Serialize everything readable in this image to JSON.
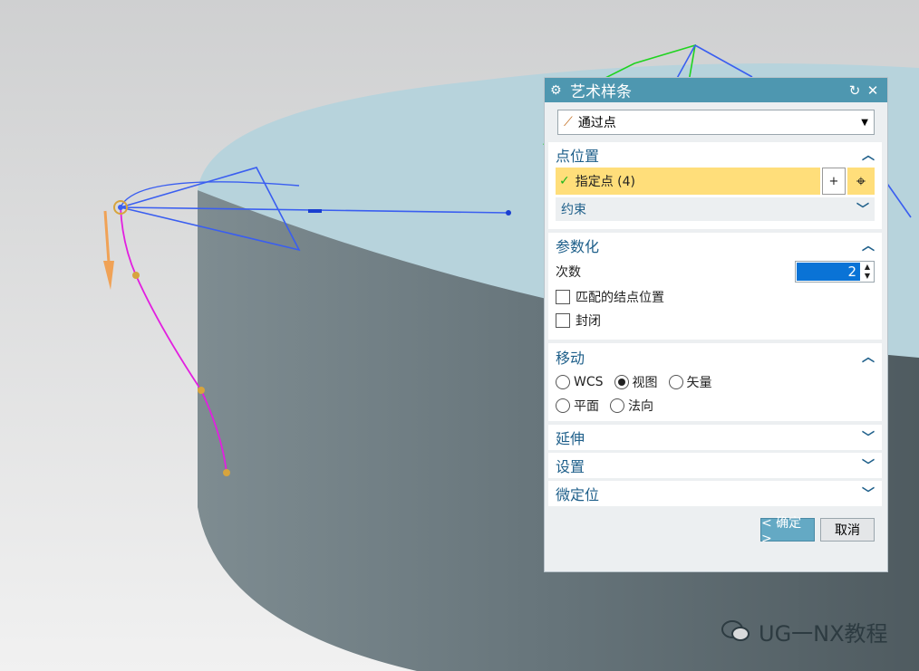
{
  "dialog": {
    "title": "艺术样条",
    "type_value": "通过点",
    "sections": {
      "point_location": {
        "label": "点位置",
        "specify_point": "指定点 (4)",
        "constraint_label": "约束"
      },
      "parameterization": {
        "label": "参数化",
        "degree_label": "次数",
        "degree_value": "2",
        "match_knots_label": "匹配的结点位置",
        "closed_label": "封闭"
      },
      "movement": {
        "label": "移动",
        "options": [
          "WCS",
          "视图",
          "矢量",
          "平面",
          "法向"
        ],
        "selected": "视图"
      },
      "extend": {
        "label": "延伸"
      },
      "settings": {
        "label": "设置"
      },
      "fine_tune": {
        "label": "微定位"
      }
    },
    "buttons": {
      "ok": "< 确定 >",
      "cancel": "取消"
    }
  },
  "watermark": "UG一NX教程",
  "colors": {
    "title_bar": "#4e97b0",
    "highlight_row": "#ffde7a",
    "spline_magenta": "#e21fe0",
    "polygon_blue": "#3a5ef0",
    "cylinder_top": "#b7d3dc",
    "cylinder_side": "#6d7b80"
  }
}
